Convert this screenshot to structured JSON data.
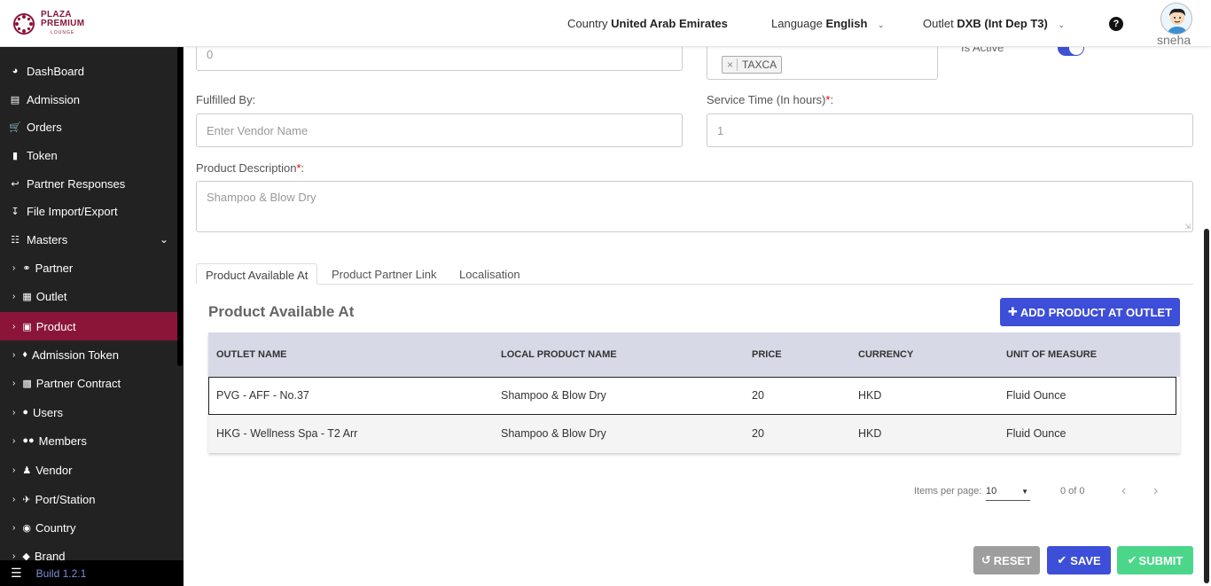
{
  "header": {
    "logo_line1": "PLAZA",
    "logo_line2": "PREMIUM",
    "logo_line3": "LOUNGE",
    "country_label": "Country",
    "country_value": "United Arab Emirates",
    "language_label": "Language",
    "language_value": "English",
    "outlet_label": "Outlet",
    "outlet_value": "DXB (Int Dep T3)",
    "user_name": "sneha"
  },
  "sidebar": {
    "items": [
      {
        "label": "DashBoard",
        "icon": "dashboard-icon"
      },
      {
        "label": "Admission",
        "icon": "id-card-icon"
      },
      {
        "label": "Orders",
        "icon": "cart-icon"
      },
      {
        "label": "Token",
        "icon": "file-icon"
      },
      {
        "label": "Partner Responses",
        "icon": "reply-icon"
      },
      {
        "label": "File Import/Export",
        "icon": "download-icon"
      },
      {
        "label": "Masters",
        "icon": "sitemap-icon"
      },
      {
        "label": "Partner",
        "icon": "handshake-icon"
      },
      {
        "label": "Outlet",
        "icon": "building-icon"
      },
      {
        "label": "Product",
        "icon": "gift-icon"
      },
      {
        "label": "Admission Token",
        "icon": "ticket-icon"
      },
      {
        "label": "Partner Contract",
        "icon": "briefcase-icon"
      },
      {
        "label": "Users",
        "icon": "user-icon"
      },
      {
        "label": "Members",
        "icon": "users-icon"
      },
      {
        "label": "Vendor",
        "icon": "person-icon"
      },
      {
        "label": "Port/Station",
        "icon": "plane-icon"
      },
      {
        "label": "Country",
        "icon": "globe-icon"
      },
      {
        "label": "Brand",
        "icon": "tag-icon"
      }
    ],
    "build_label": "Build 1.2.1"
  },
  "form": {
    "top_input_value": "0",
    "tax_chip": "TAXCA",
    "is_active_label": "Is Active",
    "fulfilled_by_label": "Fulfilled By:",
    "fulfilled_by_placeholder": "Enter Vendor Name",
    "service_time_label": "Service Time (In hours)",
    "service_time_value": "1",
    "description_label": "Product Description",
    "description_value": "Shampoo & Blow Dry",
    "required_mark": "*",
    "colon": ":"
  },
  "tabs": [
    "Product Available At",
    "Product Partner Link",
    "Localisation"
  ],
  "section": {
    "title": "Product Available At",
    "add_button": "ADD PRODUCT AT OUTLET"
  },
  "table": {
    "columns": [
      "OUTLET NAME",
      "LOCAL PRODUCT NAME",
      "PRICE",
      "CURRENCY",
      "UNIT OF MEASURE"
    ],
    "rows": [
      [
        "PVG - AFF - No.37",
        "Shampoo & Blow Dry",
        "20",
        "HKD",
        "Fluid Ounce"
      ],
      [
        "HKG - Wellness Spa - T2 Arr",
        "Shampoo & Blow Dry",
        "20",
        "HKD",
        "Fluid Ounce"
      ]
    ]
  },
  "pagination": {
    "items_per_page_label": "Items per page:",
    "items_per_page_value": "10",
    "range_label": "0 of 0"
  },
  "actions": {
    "reset": "RESET",
    "save": "SAVE",
    "submit": "SUBMIT"
  },
  "colors": {
    "brand": "#8a1538",
    "primary": "#3d4ed8",
    "submit": "#4cd68a",
    "reset": "#9e9e9e"
  }
}
